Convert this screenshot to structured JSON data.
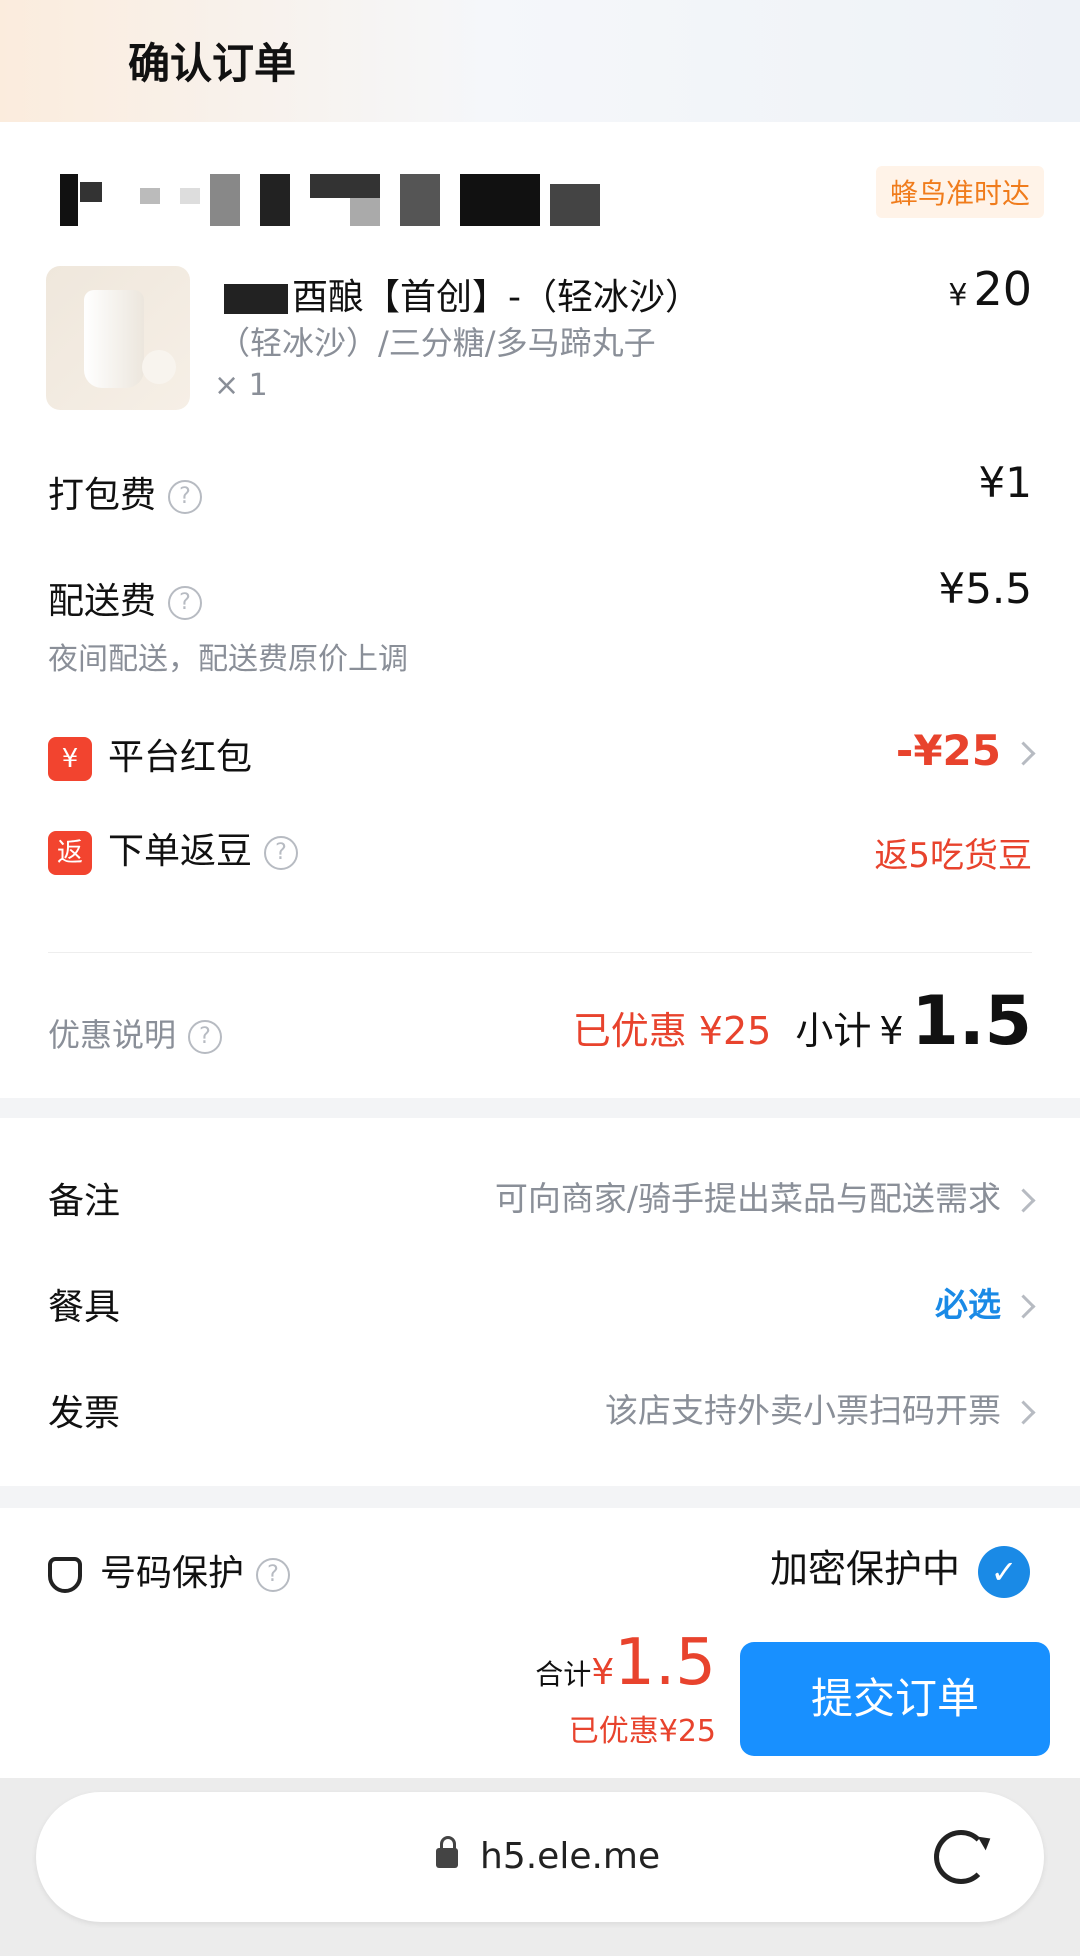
{
  "header": {
    "title": "确认订单"
  },
  "store": {
    "badge": "蜂鸟准时达"
  },
  "item": {
    "name": "酉酿【首创】-（轻冰沙）",
    "spec": "（轻冰沙）/三分糖/多马蹄丸子",
    "qty": "× 1",
    "price_symbol": "¥",
    "price": "20"
  },
  "fees": {
    "packing_label": "打包费",
    "packing_value": "¥1",
    "delivery_label": "配送费",
    "delivery_value": "¥5.5",
    "delivery_note": "夜间配送，配送费原价上调"
  },
  "promos": {
    "hongbao_icon": "¥",
    "hongbao_label": "平台红包",
    "hongbao_value": "-¥25",
    "fandou_icon": "返",
    "fandou_label": "下单返豆",
    "fandou_value": "返5吃货豆"
  },
  "summary": {
    "label": "优惠说明",
    "saved": "已优惠 ¥25",
    "subtotal_label": "小计",
    "subtotal_symbol": "¥",
    "subtotal_value": "1.5"
  },
  "options": {
    "note_label": "备注",
    "note_value": "可向商家/骑手提出菜品与配送需求",
    "utensils_label": "餐具",
    "utensils_value": "必选",
    "invoice_label": "发票",
    "invoice_value": "该店支持外卖小票扫码开票"
  },
  "privacy": {
    "label": "号码保护",
    "status": "加密保护中"
  },
  "footer": {
    "total_label": "合计",
    "total_symbol": "¥",
    "total_value": "1.5",
    "total_saved": "已优惠¥25",
    "submit_label": "提交订单"
  },
  "browser": {
    "url": "h5.ele.me"
  },
  "colors": {
    "accent_blue": "#1890ff",
    "discount_red": "#e8432d",
    "badge_orange": "#f07c1c"
  }
}
